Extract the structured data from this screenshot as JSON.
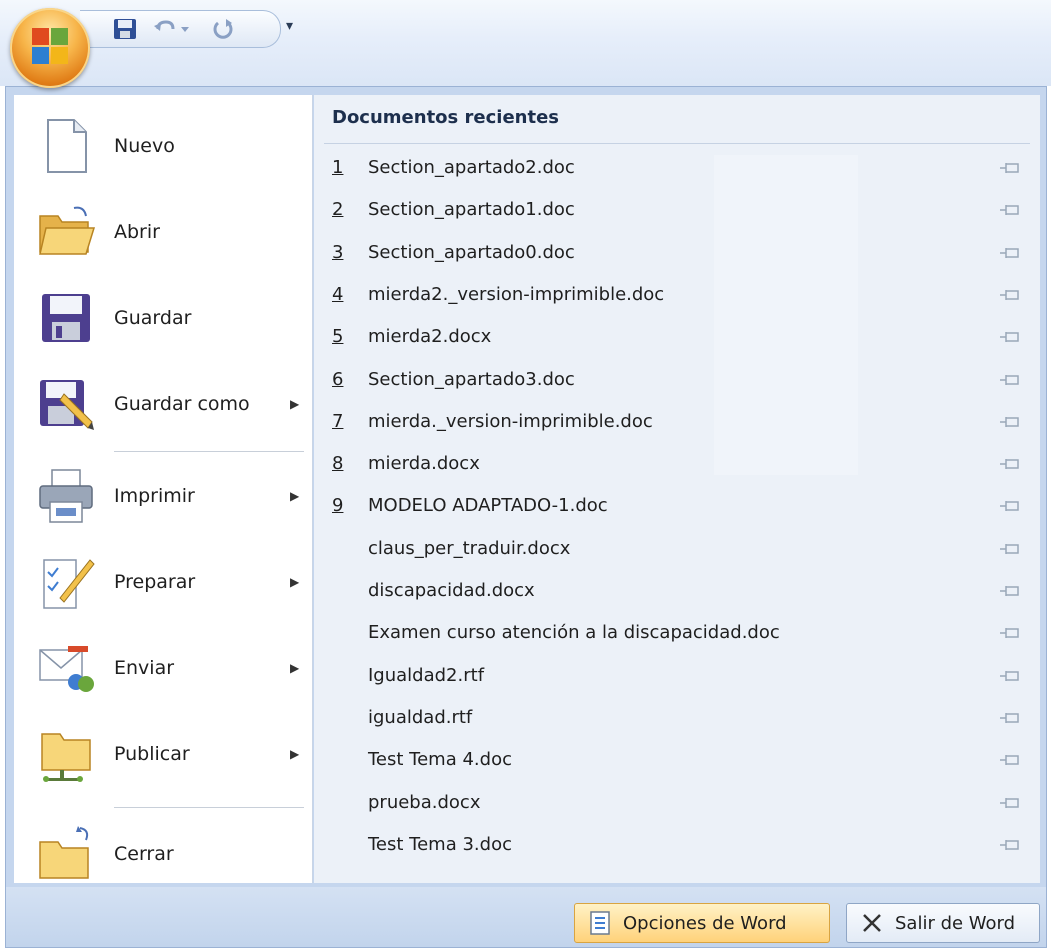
{
  "quick_access": {
    "more_label": "▾"
  },
  "commands": [
    {
      "label": "Nuevo",
      "has_submenu": false,
      "icon": "new-document-icon"
    },
    {
      "label": "Abrir",
      "has_submenu": false,
      "icon": "open-folder-icon"
    },
    {
      "label": "Guardar",
      "has_submenu": false,
      "icon": "save-disk-icon"
    },
    {
      "label": "Guardar como",
      "has_submenu": true,
      "icon": "save-as-icon"
    },
    {
      "label": "Imprimir",
      "has_submenu": true,
      "icon": "printer-icon"
    },
    {
      "label": "Preparar",
      "has_submenu": true,
      "icon": "prepare-icon"
    },
    {
      "label": "Enviar",
      "has_submenu": true,
      "icon": "send-icon"
    },
    {
      "label": "Publicar",
      "has_submenu": true,
      "icon": "publish-icon"
    },
    {
      "label": "Cerrar",
      "has_submenu": false,
      "icon": "close-folder-icon"
    }
  ],
  "recent": {
    "title": "Documentos recientes",
    "items": [
      {
        "num": "1",
        "name": "Section_apartado2.doc"
      },
      {
        "num": "2",
        "name": "Section_apartado1.doc"
      },
      {
        "num": "3",
        "name": "Section_apartado0.doc"
      },
      {
        "num": "4",
        "name": "mierda2._version-imprimible.doc"
      },
      {
        "num": "5",
        "name": "mierda2.docx"
      },
      {
        "num": "6",
        "name": "Section_apartado3.doc"
      },
      {
        "num": "7",
        "name": "mierda._version-imprimible.doc"
      },
      {
        "num": "8",
        "name": "mierda.docx"
      },
      {
        "num": "9",
        "name": "MODELO ADAPTADO-1.doc"
      },
      {
        "num": "",
        "name": "claus_per_traduir.docx"
      },
      {
        "num": "",
        "name": "discapacidad.docx"
      },
      {
        "num": "",
        "name": "Examen curso atención a la discapacidad.doc"
      },
      {
        "num": "",
        "name": "Igualdad2.rtf"
      },
      {
        "num": "",
        "name": "igualdad.rtf"
      },
      {
        "num": "",
        "name": "Test Tema 4.doc"
      },
      {
        "num": "",
        "name": "prueba.docx"
      },
      {
        "num": "",
        "name": "Test Tema 3.doc"
      }
    ]
  },
  "buttons": {
    "options": "Opciones de Word",
    "exit": "Salir de Word"
  },
  "colors": {
    "menu_bg": "#c5d6ee",
    "recent_bg": "#ecf1f8",
    "options_button": "#ffd27a"
  }
}
